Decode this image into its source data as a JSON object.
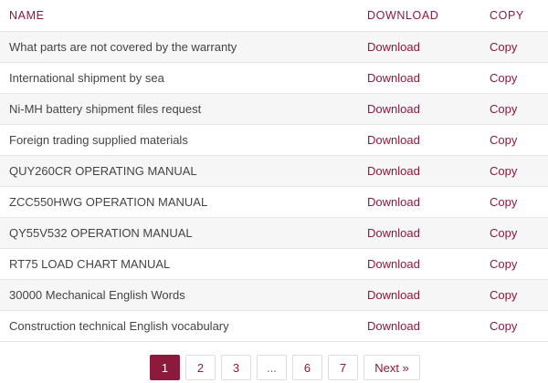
{
  "table": {
    "headers": {
      "name": "NAME",
      "download": "DOWNLOAD",
      "copy": "COPY"
    },
    "rows": [
      {
        "name": "What parts are not covered by the warranty",
        "download": "Download",
        "copy": "Copy"
      },
      {
        "name": "International shipment by sea",
        "download": "Download",
        "copy": "Copy"
      },
      {
        "name": "Ni-MH battery shipment files request",
        "download": "Download",
        "copy": "Copy"
      },
      {
        "name": "Foreign trading supplied materials",
        "download": "Download",
        "copy": "Copy"
      },
      {
        "name": "QUY260CR OPERATING MANUAL",
        "download": "Download",
        "copy": "Copy"
      },
      {
        "name": "ZCC550HWG OPERATION MANUAL",
        "download": "Download",
        "copy": "Copy"
      },
      {
        "name": "QY55V532 OPERATION MANUAL",
        "download": "Download",
        "copy": "Copy"
      },
      {
        "name": "RT75 LOAD CHART MANUAL",
        "download": "Download",
        "copy": "Copy"
      },
      {
        "name": "30000 Mechanical English Words",
        "download": "Download",
        "copy": "Copy"
      },
      {
        "name": "Construction technical English vocabulary",
        "download": "Download",
        "copy": "Copy"
      }
    ]
  },
  "pagination": {
    "pages": [
      "1",
      "2",
      "3",
      "...",
      "6",
      "7"
    ],
    "current": "1",
    "next_label": "Next »"
  },
  "colors": {
    "accent": "#8b1a3c",
    "row_stripe": "#f6f6f6"
  }
}
